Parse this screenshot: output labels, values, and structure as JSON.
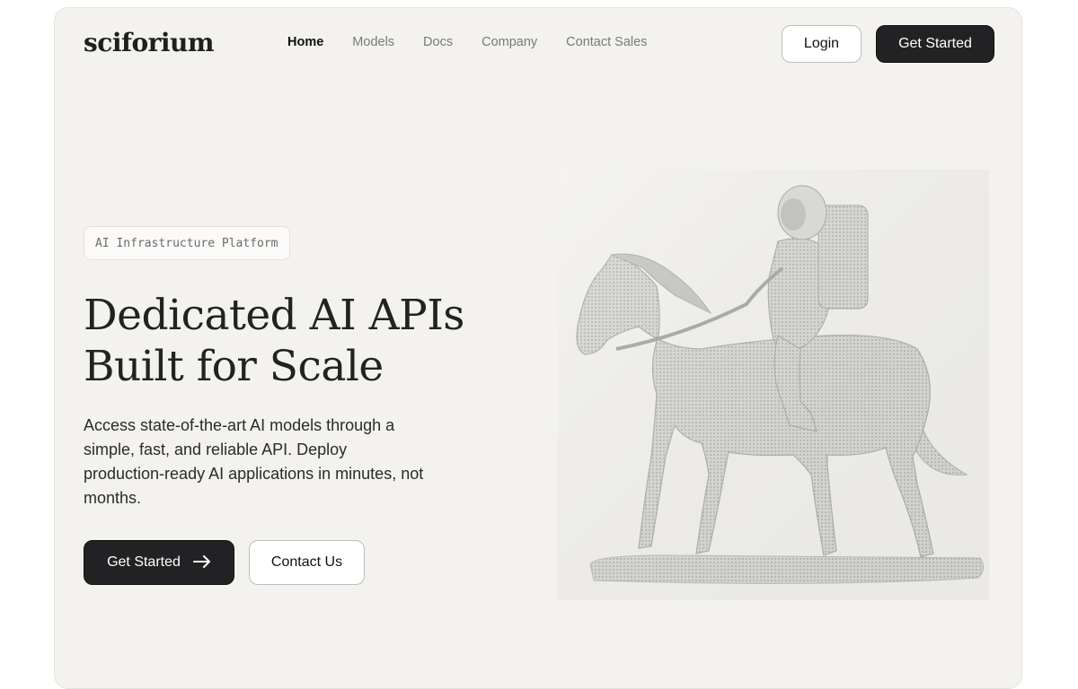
{
  "header": {
    "logo": "sciforium",
    "nav": [
      {
        "label": "Home",
        "active": true
      },
      {
        "label": "Models",
        "active": false
      },
      {
        "label": "Docs",
        "active": false
      },
      {
        "label": "Company",
        "active": false
      },
      {
        "label": "Contact Sales",
        "active": false
      }
    ],
    "login_label": "Login",
    "get_started_label": "Get Started"
  },
  "hero": {
    "badge": "AI Infrastructure Platform",
    "title_line1": "Dedicated AI APIs",
    "title_line2": "Built for Scale",
    "description": "Access state-of-the-art AI models through a simple, fast, and reliable API. Deploy production-ready AI applications in minutes, not months.",
    "primary_cta": "Get Started",
    "primary_cta_icon": "arrow-right-icon",
    "secondary_cta": "Contact Us",
    "image": "astronaut-riding-horse-statue"
  },
  "colors": {
    "background": "#f3f2ef",
    "primary_button": "#222224",
    "text": "#1f1f1f",
    "muted_text": "#7a7a7a"
  }
}
